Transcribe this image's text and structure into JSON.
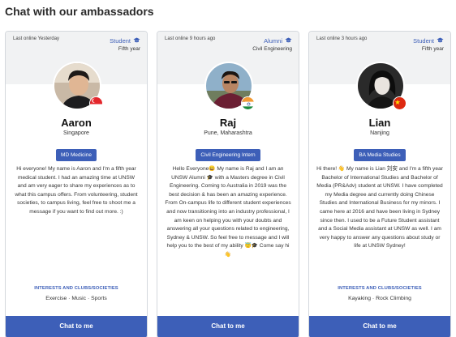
{
  "title": "Chat with our ambassadors",
  "interests_heading": "INTERESTS AND CLUBS/SOCIETIES",
  "chat_label": "Chat to me",
  "colors": {
    "accent": "#3d5fb8",
    "card_top": "#f1f2f3"
  },
  "ambassadors": [
    {
      "last_online": "Last online Yesterday",
      "role": "Student",
      "role_icon": "graduation-cap-icon",
      "subrole": "Fifth year",
      "name": "Aaron",
      "location": "Singapore",
      "flag": "singapore-flag",
      "course": "MD Medicine",
      "bio": "Hi everyone! My name is Aaron and I'm a fifth year medical student. I had an amazing time at UNSW and am very eager to share my experiences as to what this campus offers. From volunteering, student societies, to campus living, feel free to shoot me a message if you want to find out more. :)",
      "interests": "Exercise · Music · Sports"
    },
    {
      "last_online": "Last online 9 hours ago",
      "role": "Alumni",
      "role_icon": "graduation-cap-icon",
      "subrole": "Civil Engineering",
      "name": "Raj",
      "location": "Pune, Maharashtra",
      "flag": "india-flag",
      "course": "Civil Engineering Intern",
      "bio": "Hello Everyone😀 My name is Raj and I am an UNSW Alumni 🎓 with a Masters degree in Civil Engineering. Coming to Australia in 2019 was the best decision & has been an amazing experience. From On-campus life to different student experiences and now transitioning into an industry professional, I am keen on helping you with your doubts and answering all your questions related to engineering, Sydney & UNSW. So feel free to message and I will help you to the best of my ability 😇🎓 Come say hi 👋",
      "interests": ""
    },
    {
      "last_online": "Last online 3 hours ago",
      "role": "Student",
      "role_icon": "graduation-cap-icon",
      "subrole": "Fifth year",
      "name": "Lian",
      "location": "Nanjing",
      "flag": "china-flag",
      "course": "BA Media Studies",
      "bio": "Hi there! 👋 My name is Lian 刘安 and I'm a fifth year Bachelor of International Studies and Bachelor of Media (PR&Adv) student at UNSW. I have completed my Media degree and currently doing Chinese Studies and International Business for my minors. I came here at 2016 and have been living in Sydney since then. I used to be a Future Student assistant and a Social Media assistant at UNSW as well. I am very happy to answer any questions about study or life at UNSW Sydney!",
      "interests": "Kayaking · Rock Climbing"
    }
  ]
}
